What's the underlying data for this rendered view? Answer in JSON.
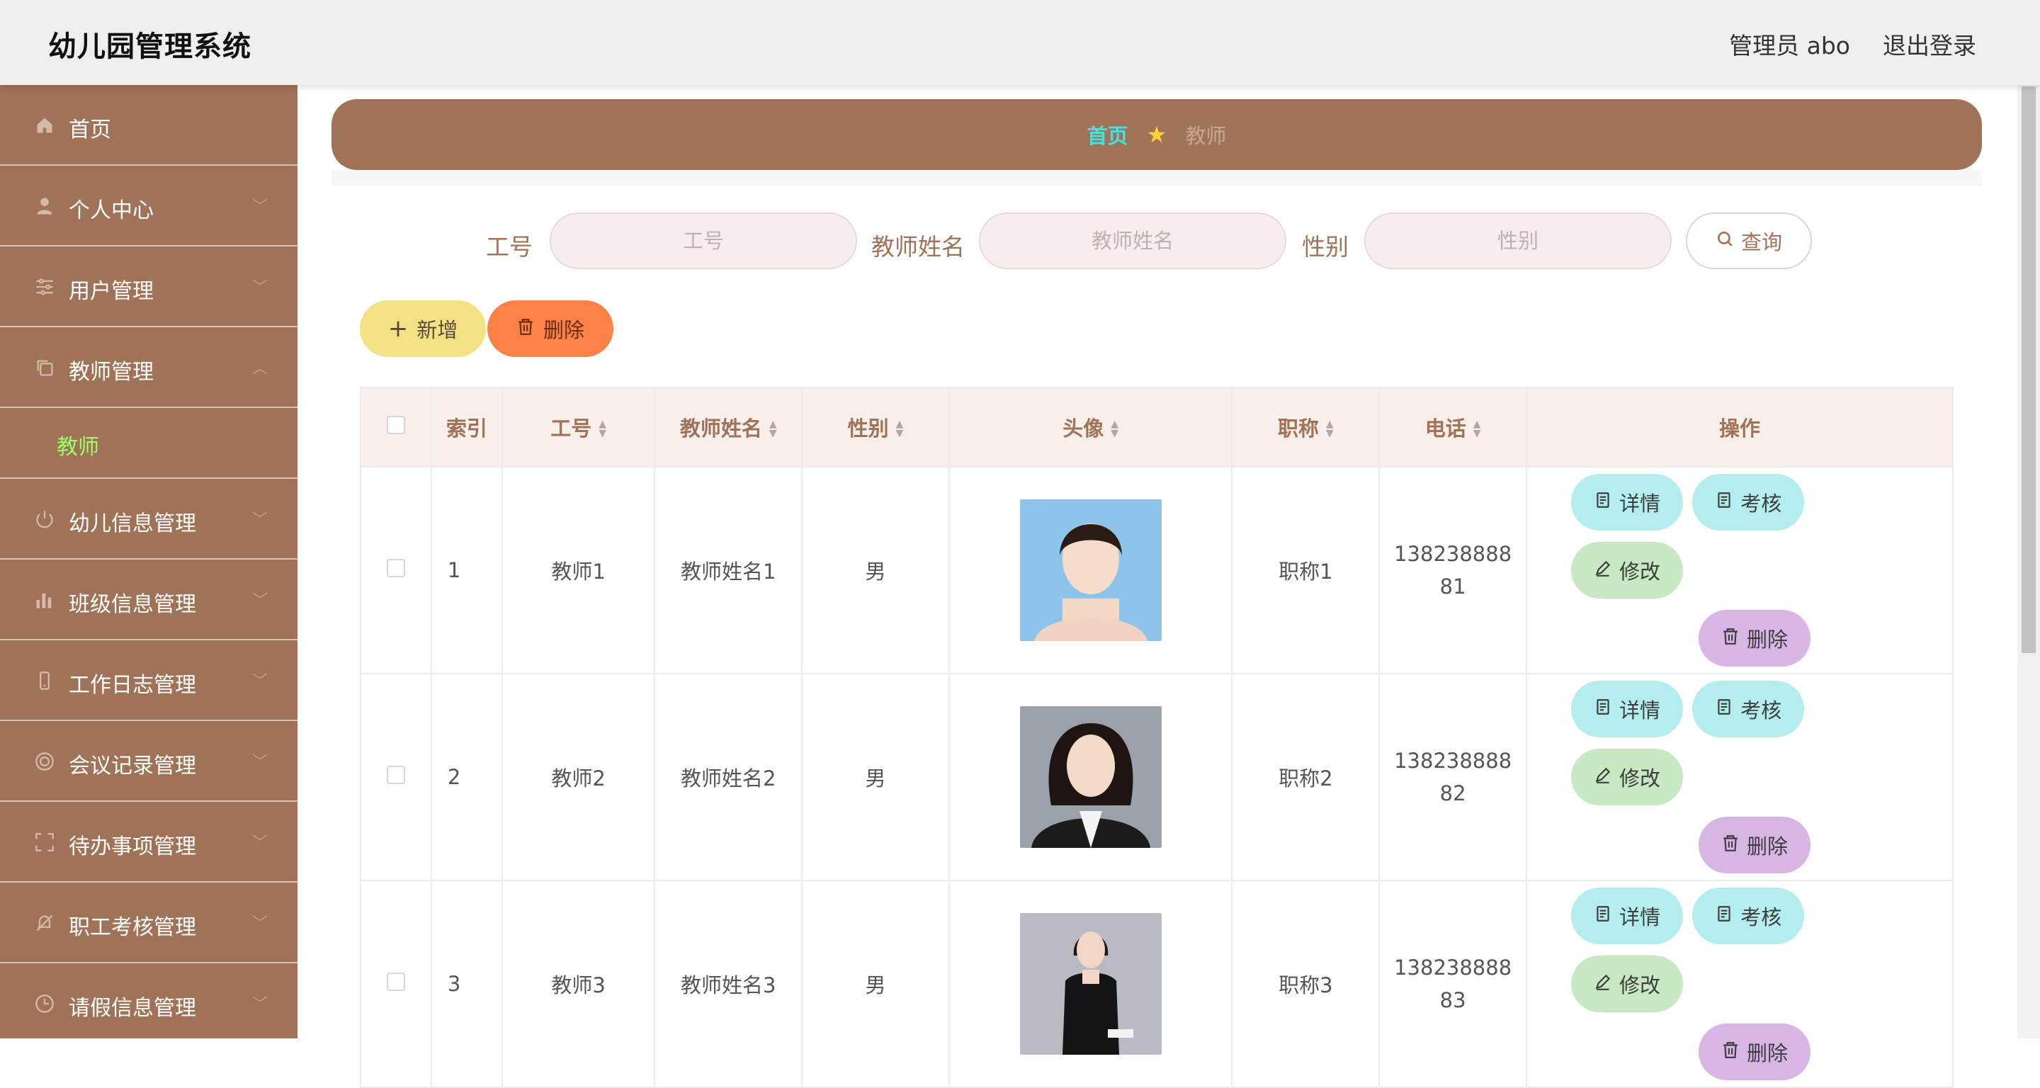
{
  "header": {
    "app_title": "幼儿园管理系统",
    "admin_label": "管理员 abo",
    "logout_label": "退出登录"
  },
  "sidebar": {
    "items": [
      {
        "label": "首页",
        "icon": "home-icon"
      },
      {
        "label": "个人中心",
        "icon": "user-icon"
      },
      {
        "label": "用户管理",
        "icon": "sliders-icon"
      },
      {
        "label": "教师管理",
        "icon": "copy-icon",
        "expanded": true,
        "children": [
          {
            "label": "教师"
          }
        ]
      },
      {
        "label": "幼儿信息管理",
        "icon": "power-icon"
      },
      {
        "label": "班级信息管理",
        "icon": "bar-chart-icon"
      },
      {
        "label": "工作日志管理",
        "icon": "phone-icon"
      },
      {
        "label": "会议记录管理",
        "icon": "help-circle-icon"
      },
      {
        "label": "待办事项管理",
        "icon": "fullscreen-icon"
      },
      {
        "label": "职工考核管理",
        "icon": "bell-off-icon"
      },
      {
        "label": "请假信息管理",
        "icon": "clock-icon"
      }
    ]
  },
  "breadcrumb": {
    "home": "首页",
    "current": "教师"
  },
  "search": {
    "fields": [
      {
        "label": "工号",
        "placeholder": "工号"
      },
      {
        "label": "教师姓名",
        "placeholder": "教师姓名"
      },
      {
        "label": "性别",
        "placeholder": "性别"
      }
    ],
    "query_label": "查询"
  },
  "toolbar": {
    "add_label": "新增",
    "delete_label": "删除"
  },
  "table": {
    "columns": [
      "索引",
      "工号",
      "教师姓名",
      "性别",
      "头像",
      "职称",
      "电话",
      "操作"
    ],
    "rows": [
      {
        "index": "1",
        "job_no": "教师1",
        "name": "教师姓名1",
        "gender": "男",
        "title": "职称1",
        "phone": "13823888881"
      },
      {
        "index": "2",
        "job_no": "教师2",
        "name": "教师姓名2",
        "gender": "男",
        "title": "职称2",
        "phone": "13823888882"
      },
      {
        "index": "3",
        "job_no": "教师3",
        "name": "教师姓名3",
        "gender": "男",
        "title": "职称3",
        "phone": "13823888883"
      }
    ],
    "ops": {
      "detail": "详情",
      "check": "考核",
      "edit": "修改",
      "delete": "删除"
    }
  },
  "colors": {
    "brand": "#a07257",
    "header_bg": "#f3eeee",
    "active_sub": "#9bff6a",
    "crumb_home": "#47e0e0",
    "add_btn": "#f2e283",
    "del_btn": "#fb8147"
  }
}
